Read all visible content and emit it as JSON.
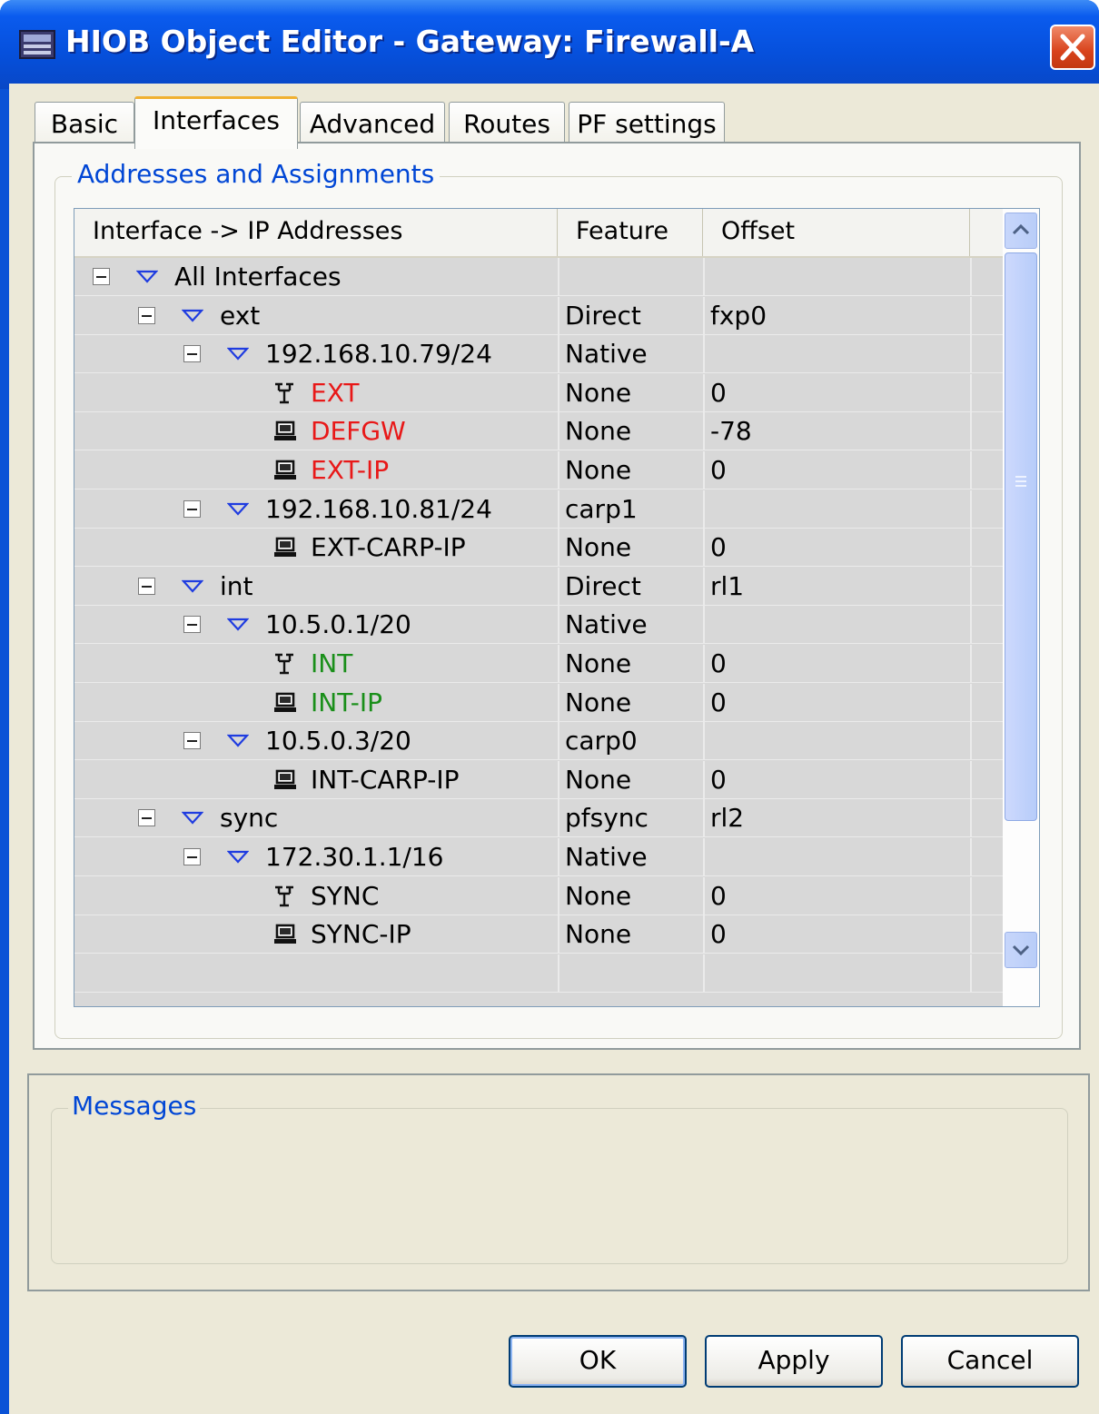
{
  "window": {
    "title": "HIOB Object Editor - Gateway: Firewall-A",
    "close_icon": "close-icon"
  },
  "tabs": [
    {
      "label": "Basic",
      "active": false
    },
    {
      "label": "Interfaces",
      "active": true
    },
    {
      "label": "Advanced",
      "active": false
    },
    {
      "label": "Routes",
      "active": false
    },
    {
      "label": "PF settings",
      "active": false
    }
  ],
  "group": {
    "title": "Addresses and Assignments"
  },
  "tree": {
    "columns": [
      "Interface -> IP Addresses",
      "Feature",
      "Offset"
    ],
    "rows": [
      {
        "level": 0,
        "kind": "branch",
        "label": "All Interfaces",
        "feature": "",
        "offset": "",
        "color": ""
      },
      {
        "level": 1,
        "kind": "branch",
        "label": "ext",
        "feature": "Direct",
        "offset": "fxp0",
        "color": ""
      },
      {
        "level": 2,
        "kind": "branch",
        "label": "192.168.10.79/24",
        "feature": "Native",
        "offset": "",
        "color": ""
      },
      {
        "level": 3,
        "kind": "network",
        "label": "EXT",
        "feature": "None",
        "offset": "0",
        "color": "red"
      },
      {
        "level": 3,
        "kind": "host",
        "label": "DEFGW",
        "feature": "None",
        "offset": "-78",
        "color": "red"
      },
      {
        "level": 3,
        "kind": "host",
        "label": "EXT-IP",
        "feature": "None",
        "offset": "0",
        "color": "red"
      },
      {
        "level": 2,
        "kind": "branch",
        "label": "192.168.10.81/24",
        "feature": "carp1",
        "offset": "",
        "color": ""
      },
      {
        "level": 3,
        "kind": "host",
        "label": "EXT-CARP-IP",
        "feature": "None",
        "offset": "0",
        "color": ""
      },
      {
        "level": 1,
        "kind": "branch",
        "label": "int",
        "feature": "Direct",
        "offset": "rl1",
        "color": ""
      },
      {
        "level": 2,
        "kind": "branch",
        "label": "10.5.0.1/20",
        "feature": "Native",
        "offset": "",
        "color": ""
      },
      {
        "level": 3,
        "kind": "network",
        "label": "INT",
        "feature": "None",
        "offset": "0",
        "color": "green"
      },
      {
        "level": 3,
        "kind": "host",
        "label": "INT-IP",
        "feature": "None",
        "offset": "0",
        "color": "green"
      },
      {
        "level": 2,
        "kind": "branch",
        "label": "10.5.0.3/20",
        "feature": "carp0",
        "offset": "",
        "color": ""
      },
      {
        "level": 3,
        "kind": "host",
        "label": "INT-CARP-IP",
        "feature": "None",
        "offset": "0",
        "color": ""
      },
      {
        "level": 1,
        "kind": "branch",
        "label": "sync",
        "feature": "pfsync",
        "offset": "rl2",
        "color": ""
      },
      {
        "level": 2,
        "kind": "branch",
        "label": "172.30.1.1/16",
        "feature": "Native",
        "offset": "",
        "color": ""
      },
      {
        "level": 3,
        "kind": "network",
        "label": "SYNC",
        "feature": "None",
        "offset": "0",
        "color": ""
      },
      {
        "level": 3,
        "kind": "host",
        "label": "SYNC-IP",
        "feature": "None",
        "offset": "0",
        "color": ""
      }
    ]
  },
  "messages": {
    "title": "Messages"
  },
  "buttons": {
    "ok": "OK",
    "apply": "Apply",
    "cancel": "Cancel"
  },
  "colors": {
    "titlebar": "#0650dc",
    "group_label": "#0046d5",
    "red": "#e81818",
    "green": "#1a8f1a",
    "tab_highlight": "#f0b030"
  }
}
